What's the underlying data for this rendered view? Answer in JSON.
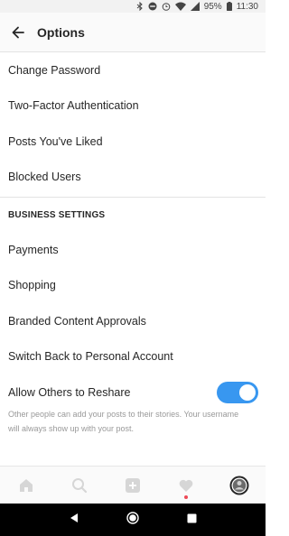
{
  "status_bar": {
    "battery": "95%",
    "time": "11:30",
    "icons": [
      "bluetooth-icon",
      "do-not-disturb-icon",
      "alarm-icon",
      "wifi-icon",
      "cell-signal-icon",
      "battery-icon"
    ]
  },
  "header": {
    "title": "Options",
    "back_icon": "back-arrow-icon"
  },
  "menu": {
    "items": [
      {
        "label": "Change Password"
      },
      {
        "label": "Two-Factor Authentication"
      },
      {
        "label": "Posts You've Liked"
      },
      {
        "label": "Blocked Users"
      }
    ]
  },
  "business": {
    "header": "BUSINESS SETTINGS",
    "items": [
      {
        "label": "Payments"
      },
      {
        "label": "Shopping"
      },
      {
        "label": "Branded Content Approvals"
      },
      {
        "label": "Switch Back to Personal Account"
      }
    ],
    "reshare": {
      "label": "Allow Others to Reshare",
      "enabled": true,
      "helper": "Other people can add your posts to their stories. Your username will always show up with your post."
    }
  },
  "tab_bar": {
    "tabs": [
      "home-icon",
      "search-icon",
      "add-post-icon",
      "activity-heart-icon",
      "profile-avatar"
    ],
    "notification_dot_color": "#ed4956"
  },
  "colors": {
    "accent": "#3897f0",
    "text": "#262626",
    "muted": "#999999"
  }
}
